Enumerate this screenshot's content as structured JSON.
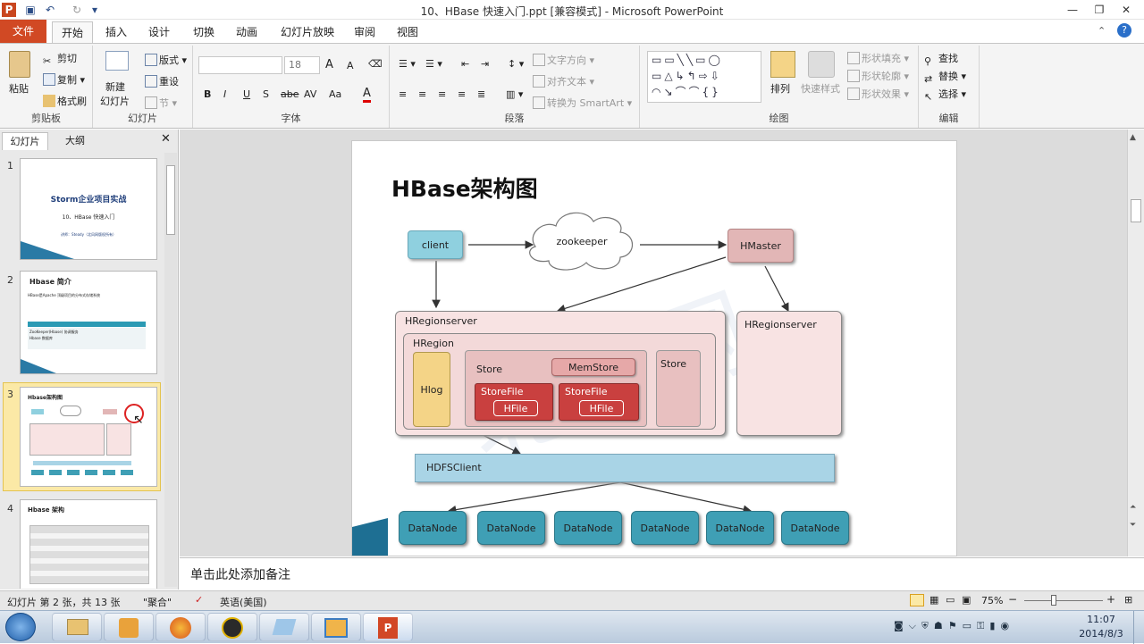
{
  "window": {
    "title": "10、HBase 快速入门.ppt [兼容模式] - Microsoft PowerPoint",
    "minimize": "—",
    "restore": "❐",
    "close": "✕"
  },
  "quick_access": {
    "app_icon": "P",
    "save": "▣",
    "undo": "↶",
    "redo": "↻",
    "customize": "▾"
  },
  "tabs": {
    "file": "文件",
    "home": "开始",
    "insert": "插入",
    "design": "设计",
    "transitions": "切换",
    "animations": "动画",
    "slideshow": "幻灯片放映",
    "review": "审阅",
    "view": "视图"
  },
  "ribbon": {
    "clipboard": {
      "paste": "粘贴",
      "cut": "剪切",
      "copy": "复制",
      "format_painter": "格式刷",
      "label": "剪贴板"
    },
    "slides": {
      "new_slide": "新建",
      "new_slide2": "幻灯片",
      "layout": "版式",
      "reset": "重设",
      "section": "节",
      "label": "幻灯片"
    },
    "font": {
      "size": "18",
      "bold": "B",
      "italic": "I",
      "underline": "U",
      "strike": "S",
      "shadow": "abe",
      "spacing": "AV",
      "case": "Aa",
      "color": "A",
      "grow": "A",
      "shrink": "A",
      "label": "字体"
    },
    "paragraph": {
      "text_direction": "文字方向",
      "align_text": "对齐文本",
      "smartart": "转换为 SmartArt",
      "label": "段落"
    },
    "drawing": {
      "arrange": "排列",
      "quick_styles": "快速样式",
      "fill": "形状填充",
      "outline": "形状轮廓",
      "effects": "形状效果",
      "label": "绘图"
    },
    "editing": {
      "find": "查找",
      "replace": "替换",
      "select": "选择",
      "label": "编辑"
    }
  },
  "pane": {
    "tab_slides": "幻灯片",
    "tab_outline": "大纲",
    "close": "✕"
  },
  "thumbnails": [
    {
      "num": "1",
      "title": "Storm企业项目实战",
      "subtitle": "10、HBase 快速入门",
      "footer": "讲师：Steady（北风网版权所有）"
    },
    {
      "num": "2",
      "title": "Hbase 简介",
      "body1": "HBase是Apache 顶级项目的分布式存储系统",
      "table_head": [
        "名称",
        "类型",
        "描述"
      ],
      "table_rows": [
        [
          "ZooKeeper(Hbase)",
          "协调服务",
          "协调管理"
        ],
        [
          "Hbase",
          "数据库",
          "分布式列存储"
        ]
      ]
    },
    {
      "num": "3",
      "title": "Hbase架构图"
    },
    {
      "num": "4",
      "title": "Hbase 架构"
    }
  ],
  "slide": {
    "title": "HBase架构图",
    "nodes": {
      "client": "client",
      "zookeeper": "zookeeper",
      "hmaster": "HMaster",
      "hregionserver1": "HRegionserver",
      "hregionserver2": "HRegionserver",
      "hregion": "HRegion",
      "hlog": "Hlog",
      "store1": "Store",
      "store2": "Store",
      "memstore": "MemStore",
      "storefile1": "StoreFile",
      "storefile2": "StoreFile",
      "hfile1": "HFile",
      "hfile2": "HFile",
      "hdfsclient": "HDFSClient",
      "datanodes": [
        "DataNode",
        "DataNode",
        "DataNode",
        "DataNode",
        "DataNode",
        "DataNode"
      ]
    },
    "watermark": "北风网"
  },
  "notes": {
    "placeholder": "单击此处添加备注"
  },
  "status": {
    "slide_info": "幻灯片 第 2 张，共 13 张",
    "theme": "\"聚合\"",
    "language": "英语(美国)",
    "zoom": "75%",
    "zoom_minus": "−",
    "zoom_plus": "+"
  },
  "taskbar": {
    "time": "11:07",
    "date": "2014/8/3"
  },
  "colors": {
    "file_tab": "#d14924",
    "client": "#8fd0df",
    "hmaster": "#e2b6b6",
    "hregion_bg": "#f8e3e3",
    "hlog": "#f4d487",
    "storefile": "#c9403f",
    "hdfs": "#a9d4e6",
    "datanode": "#3f9fb5"
  }
}
